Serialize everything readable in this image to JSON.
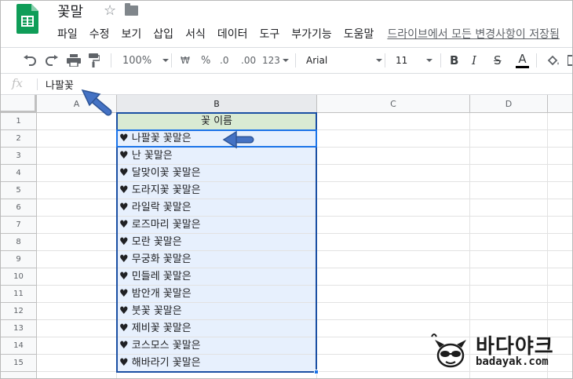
{
  "doc": {
    "title": "꽃말"
  },
  "menu": {
    "items": [
      "파일",
      "수정",
      "보기",
      "삽입",
      "서식",
      "데이터",
      "도구",
      "부가기능",
      "도움말"
    ],
    "last_save": "드라이브에서 모든 변경사항이 저장됨"
  },
  "toolbar": {
    "zoom": "100%",
    "currency": "₩",
    "percent": "%",
    "dec_less": ".0",
    "dec_more": ".00",
    "number_format": "123",
    "font": "Arial",
    "font_size": "11",
    "bold": "B",
    "italic": "I",
    "strike": "S",
    "text_color": "A"
  },
  "formula_bar": {
    "fx": "fx",
    "value": "나팔꽃"
  },
  "columns": [
    "A",
    "B",
    "C",
    "D"
  ],
  "rows": [
    "1",
    "2",
    "3",
    "4",
    "5",
    "6",
    "7",
    "8",
    "9",
    "10",
    "11",
    "12",
    "13",
    "14",
    "15"
  ],
  "column_b": [
    "꽃 이름",
    "♥ 나팔꽃 꽃말은",
    "♥ 난 꽃말은",
    "♥ 달맞이꽃 꽃말은",
    "♥ 도라지꽃 꽃말은",
    "♥ 라일락 꽃말은",
    "♥ 로즈마리 꽃말은",
    "♥ 모란 꽃말은",
    "♥ 무궁화 꽃말은",
    "♥ 민들레 꽃말은",
    "♥ 밤안개 꽃말은",
    "♥ 붓꽃 꽃말은",
    "♥ 제비꽃 꽃말은",
    "♥ 코스모스 꽃말은",
    "♥ 해바라기 꽃말은"
  ],
  "watermark": {
    "name": "바다야크",
    "url": "badayak.com"
  },
  "colors": {
    "header_fill": "#d9ead3",
    "selection": "#e7f0fd",
    "selection_border": "#1a4fa3",
    "arrow": "#4472c4",
    "sheets_green": "#0f9d58"
  }
}
